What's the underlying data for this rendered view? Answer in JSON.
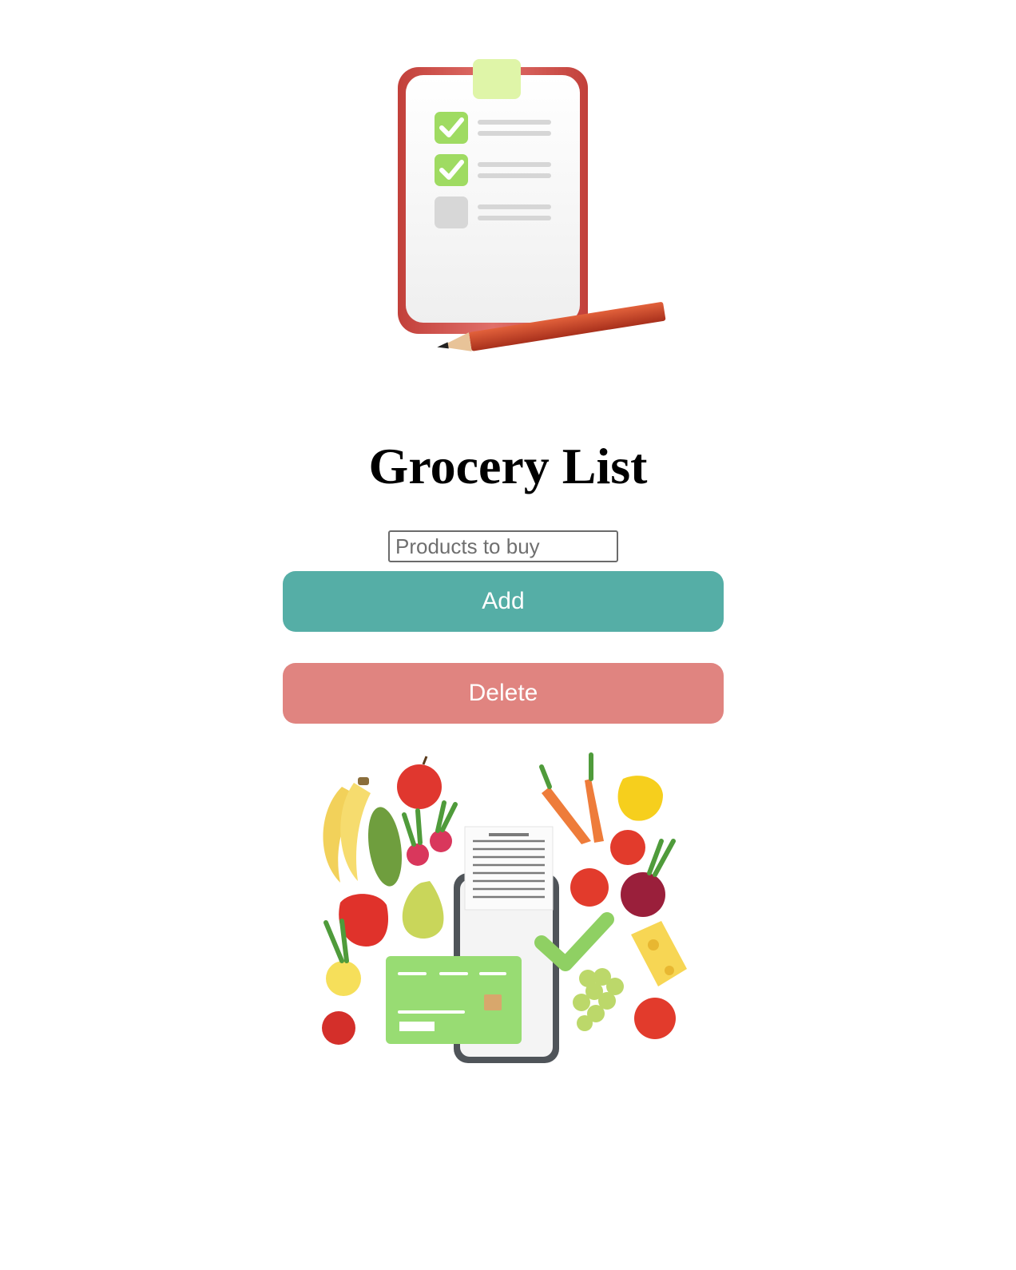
{
  "page": {
    "title": "Grocery List"
  },
  "form": {
    "input_placeholder": "Products to buy",
    "input_value": "",
    "add_label": "Add",
    "delete_label": "Delete"
  },
  "colors": {
    "add_button": "#55aea6",
    "delete_button": "#e08480",
    "background": "#ffffff"
  },
  "images": {
    "top": "clipboard-checklist-with-pencil",
    "bottom": "groceries-phone-receipt-credit-card"
  }
}
